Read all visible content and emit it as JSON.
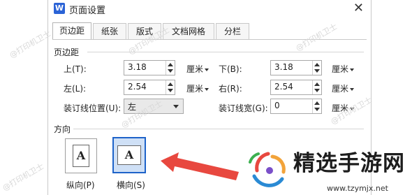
{
  "window": {
    "app_icon_text": "W",
    "title": "页面设置",
    "close_glyph": "✕"
  },
  "tabs": [
    {
      "label": "页边距",
      "active": true
    },
    {
      "label": "纸张",
      "active": false
    },
    {
      "label": "版式",
      "active": false
    },
    {
      "label": "文档网格",
      "active": false
    },
    {
      "label": "分栏",
      "active": false
    }
  ],
  "margins": {
    "section_title": "页边距",
    "top": {
      "label": "上(T):",
      "value": "3.18",
      "unit": "厘米"
    },
    "bottom": {
      "label": "下(B):",
      "value": "3.18",
      "unit": "厘米"
    },
    "left": {
      "label": "左(L):",
      "value": "2.54",
      "unit": "厘米"
    },
    "right": {
      "label": "右(R):",
      "value": "2.54",
      "unit": "厘米"
    },
    "gutter_position": {
      "label": "装订线位置(U):",
      "value": "左"
    },
    "gutter_width": {
      "label": "装订线宽(G):",
      "value": "0",
      "unit": "厘米"
    }
  },
  "orientation": {
    "section_title": "方向",
    "portrait": {
      "label": "纵向(P)",
      "glyph": "A",
      "selected": false
    },
    "landscape": {
      "label": "横向(S)",
      "glyph": "A",
      "selected": true
    }
  },
  "overlay": {
    "arrow_color": "#e8483f",
    "brand_name": "精选手游网",
    "brand_url": "www.tzymjx.net",
    "watermark": "@打印机卫士"
  }
}
